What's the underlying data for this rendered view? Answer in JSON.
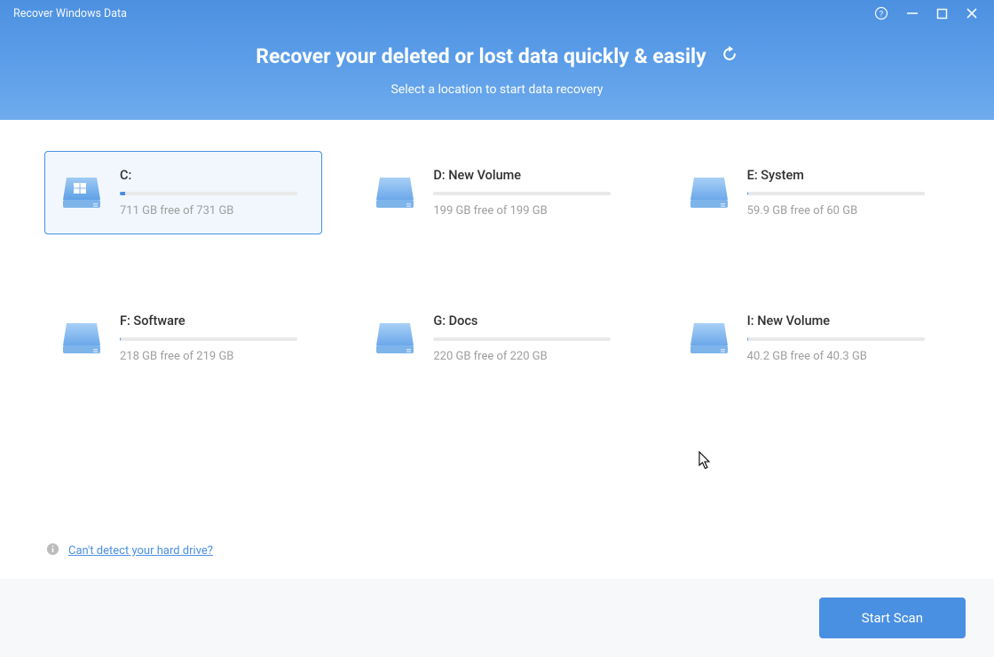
{
  "app_title": "Recover Windows Data",
  "headline": "Recover your deleted or lost data quickly & easily",
  "subheadline": "Select a location to start data recovery",
  "drives": [
    {
      "label": "C:",
      "info": "711 GB free of 731 GB",
      "used_pct": 3,
      "selected": true,
      "windows": true
    },
    {
      "label": "D: New Volume",
      "info": "199 GB free of 199 GB",
      "used_pct": 0,
      "selected": false,
      "windows": false
    },
    {
      "label": "E: System",
      "info": "59.9 GB free of 60 GB",
      "used_pct": 0.2,
      "selected": false,
      "windows": false
    },
    {
      "label": "F: Software",
      "info": "218 GB free of 219 GB",
      "used_pct": 0.5,
      "selected": false,
      "windows": false
    },
    {
      "label": "G: Docs",
      "info": "220 GB free of 220 GB",
      "used_pct": 0,
      "selected": false,
      "windows": false
    },
    {
      "label": "I: New Volume",
      "info": "40.2 GB free of 40.3 GB",
      "used_pct": 0.2,
      "selected": false,
      "windows": false
    }
  ],
  "detect_link": "Can't detect your hard drive?",
  "scan_button": "Start Scan",
  "colors": {
    "accent": "#4a90e2",
    "header_top": "#4c90e0",
    "header_bottom": "#6fabed",
    "footer_bg": "#f6f8fa"
  }
}
